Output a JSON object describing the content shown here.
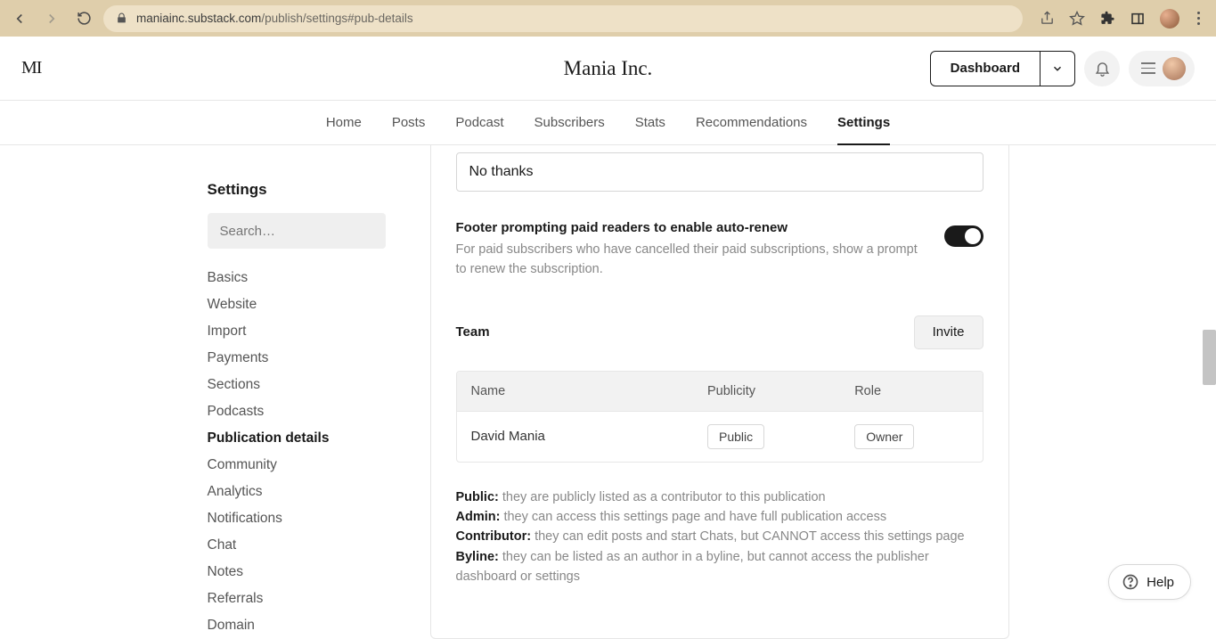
{
  "browser": {
    "url_host": "maniainc.substack.com",
    "url_path": "/publish/settings#pub-details"
  },
  "header": {
    "logo_text": "MI",
    "title": "Mania Inc.",
    "dashboard_label": "Dashboard"
  },
  "nav": {
    "tabs": [
      "Home",
      "Posts",
      "Podcast",
      "Subscribers",
      "Stats",
      "Recommendations",
      "Settings"
    ],
    "active_index": 6
  },
  "sidebar": {
    "heading": "Settings",
    "search_placeholder": "Search…",
    "items": [
      "Basics",
      "Website",
      "Import",
      "Payments",
      "Sections",
      "Podcasts",
      "Publication details",
      "Community",
      "Analytics",
      "Notifications",
      "Chat",
      "Notes",
      "Referrals",
      "Domain"
    ],
    "active_index": 6
  },
  "panel": {
    "input_value": "No thanks",
    "auto_renew": {
      "title": "Footer prompting paid readers to enable auto-renew",
      "desc": "For paid subscribers who have cancelled their paid subscriptions, show a prompt to renew the subscription.",
      "enabled": true
    },
    "team": {
      "heading": "Team",
      "invite_label": "Invite",
      "columns": [
        "Name",
        "Publicity",
        "Role"
      ],
      "rows": [
        {
          "name": "David Mania",
          "publicity": "Public",
          "role": "Owner"
        }
      ]
    },
    "role_defs": {
      "public_label": "Public:",
      "public_text": " they are publicly listed as a contributor to this publication",
      "admin_label": "Admin:",
      "admin_text": " they can access this settings page and have full publication access",
      "contributor_label": "Contributor:",
      "contributor_text": " they can edit posts and start Chats, but CANNOT access this settings page",
      "byline_label": "Byline:",
      "byline_text": " they can be listed as an author in a byline, but cannot access the publisher dashboard or settings"
    }
  },
  "help_label": "Help"
}
